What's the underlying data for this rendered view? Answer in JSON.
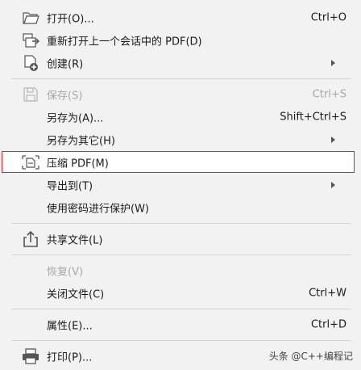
{
  "menu": {
    "open": {
      "label": "打开(O)...",
      "shortcut": "Ctrl+O"
    },
    "reopen": {
      "label": "重新打开上一个会话中的 PDF(D)"
    },
    "create": {
      "label": "创建(R)"
    },
    "save": {
      "label": "保存(S)",
      "shortcut": "Ctrl+S"
    },
    "save_as": {
      "label": "另存为(A)...",
      "shortcut": "Shift+Ctrl+S"
    },
    "save_as_other": {
      "label": "另存为其它(H)"
    },
    "compress": {
      "label": "压缩 PDF(M)"
    },
    "export_to": {
      "label": "导出到(T)"
    },
    "protect": {
      "label": "使用密码进行保护(W)"
    },
    "share": {
      "label": "共享文件(L)"
    },
    "revert": {
      "label": "恢复(V)"
    },
    "close": {
      "label": "关闭文件(C)",
      "shortcut": "Ctrl+W"
    },
    "properties": {
      "label": "属性(E)...",
      "shortcut": "Ctrl+D"
    },
    "print": {
      "label": "打印(P)..."
    }
  },
  "watermark": {
    "text": "头条 @C++编程记"
  },
  "colors": {
    "highlight_border": "#d9262b",
    "disabled_text": "#a8a8a8",
    "menu_background": "#f2f2f2"
  },
  "icons": {
    "open": "folder-open-icon",
    "reopen": "reopen-file-icon",
    "create": "create-file-icon",
    "save": "save-disk-icon",
    "compress": "compress-pdf-icon",
    "share": "share-upload-icon",
    "print": "printer-icon"
  }
}
